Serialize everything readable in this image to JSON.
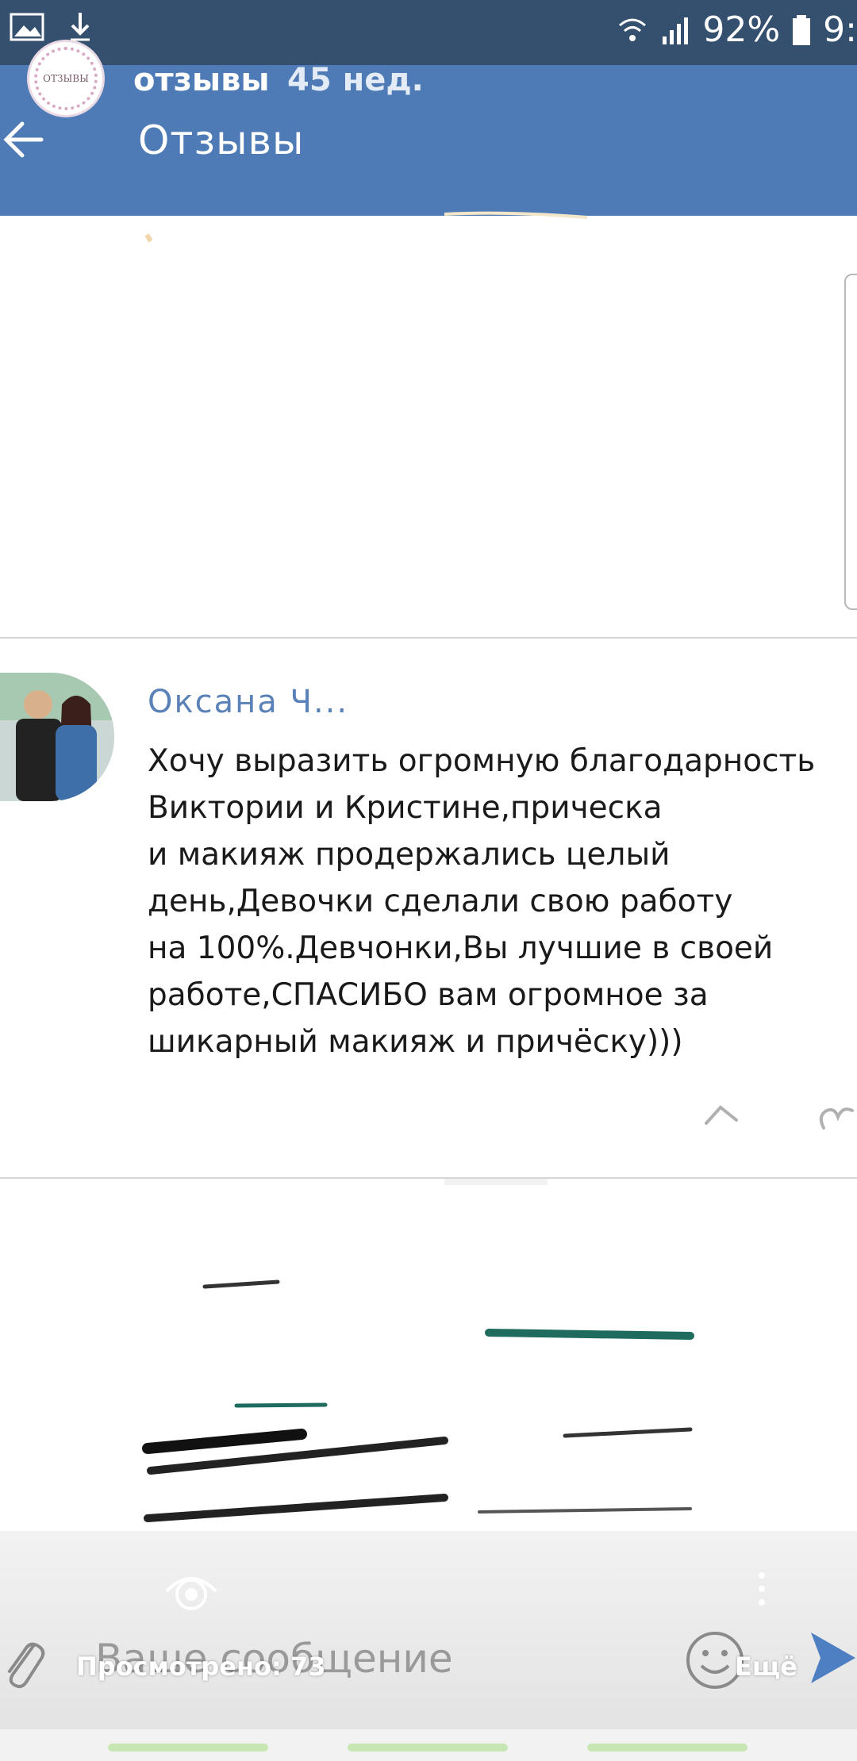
{
  "status_bar": {
    "battery_percent": "92%",
    "time": "9:"
  },
  "story": {
    "avatar_text": "ОТЗЫВЫ",
    "name": "отзывы",
    "time_ago": "45 нед."
  },
  "page": {
    "title": "Отзывы"
  },
  "comment": {
    "author": "Оксана Ч...",
    "text": "Хочу выразить огромную благодарность\nВиктории и Кристине,прическа\nи макияж продержались целый\nдень,Девочки сделали свою работу\nна 100%.Девчонки,Вы лучшие в своей\nработе,СПАСИБО вам огромное за\nшикарный макияж и причёску)))"
  },
  "composer": {
    "placeholder": "Ваше сообщение",
    "views_label": "Просмотрено: 73",
    "more_label": "Ещё"
  },
  "colors": {
    "status_bar": "#35506f",
    "app_bar": "#4e7bb6",
    "author_link": "#5a82b8",
    "send_accent": "#4d7fc2"
  }
}
